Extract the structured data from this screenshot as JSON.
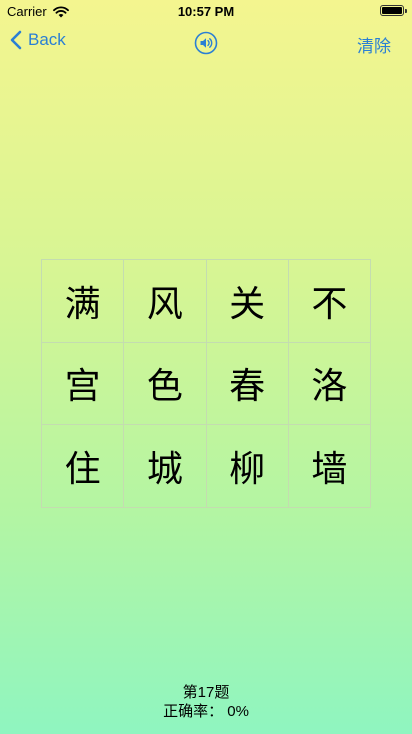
{
  "status_bar": {
    "carrier": "Carrier",
    "time": "10:57 PM",
    "battery_level": 1.0
  },
  "nav": {
    "back_label": "Back",
    "back_icon": "chevron-left-icon",
    "speaker_icon": "speaker-icon",
    "clear_label": "清除",
    "accent_color": "#2a7fd4"
  },
  "grid": {
    "cells": [
      "满",
      "风",
      "关",
      "不",
      "宫",
      "色",
      "春",
      "洛",
      "住",
      "城",
      "柳",
      "墙"
    ]
  },
  "footer": {
    "question": "第17题",
    "accuracy": "正确率： 0%"
  }
}
